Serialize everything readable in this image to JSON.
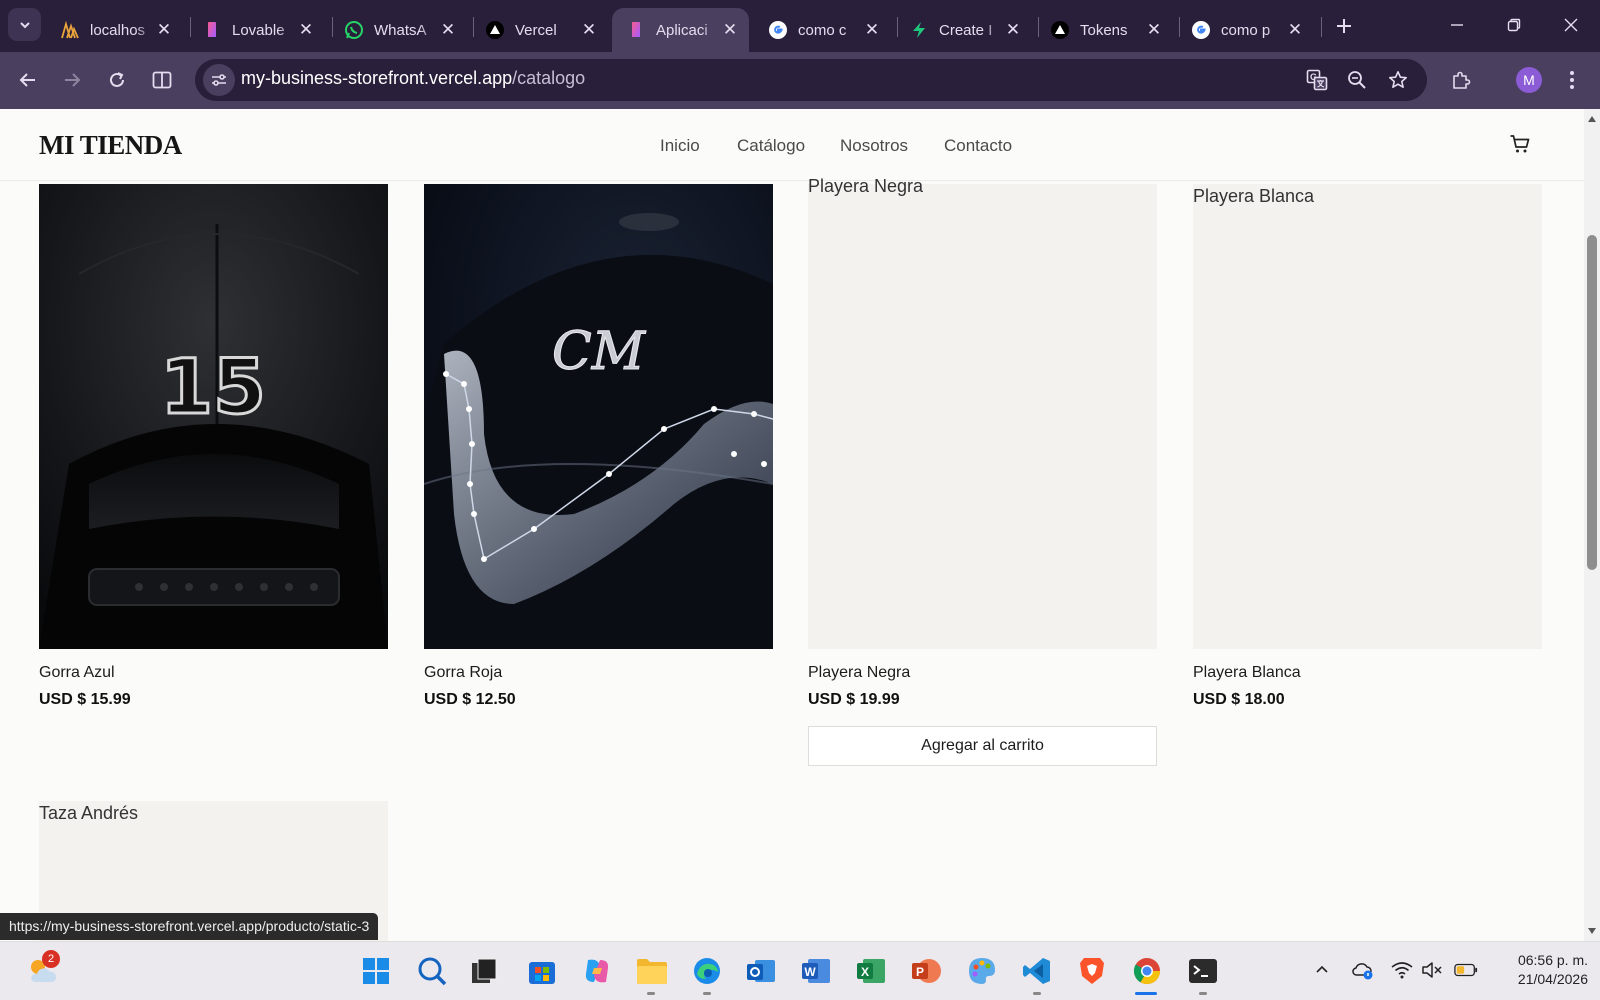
{
  "browser": {
    "tabs": [
      {
        "title": "localhos",
        "favicon": "localhost-favicon",
        "active": false
      },
      {
        "title": "Lovable",
        "favicon": "lovable-favicon",
        "active": false
      },
      {
        "title": "WhatsA",
        "favicon": "whatsapp-favicon",
        "active": false
      },
      {
        "title": "Vercel",
        "favicon": "vercel-favicon",
        "active": false
      },
      {
        "title": "Aplicaci",
        "favicon": "lovable-favicon",
        "active": true
      },
      {
        "title": "como c",
        "favicon": "google-favicon",
        "active": false
      },
      {
        "title": "Create I",
        "favicon": "bolt-favicon",
        "active": false
      },
      {
        "title": "Tokens",
        "favicon": "vercel-favicon",
        "active": false
      },
      {
        "title": "como p",
        "favicon": "google-favicon",
        "active": false
      }
    ],
    "url_domain": "my-business-storefront.vercel.app",
    "url_path": "/catalogo",
    "profile_initial": "M",
    "status_url": "https://my-business-storefront.vercel.app/producto/static-3",
    "colors": {
      "chrome_dark": "#2a1f3a",
      "chrome_toolbar": "#4a3f5e",
      "profile": "#8b5cd6"
    }
  },
  "site": {
    "logo": "MI TIENDA",
    "nav": {
      "home": "Inicio",
      "catalog": "Catálogo",
      "about": "Nosotros",
      "contact": "Contacto"
    },
    "products": [
      {
        "name": "Gorra Azul",
        "price": "USD $ 15.99",
        "image": "cap-15-photo"
      },
      {
        "name": "Gorra Roja",
        "price": "USD $ 12.50",
        "image": "cap-cm-constellation-photo"
      },
      {
        "name": "Playera Negra",
        "price": "USD $ 19.99",
        "image_alt": "Playera Negra",
        "button": "Agregar al carrito"
      },
      {
        "name": "Playera Blanca",
        "price": "USD $ 18.00",
        "image_alt": "Playera Blanca"
      },
      {
        "image_alt": "Taza Andrés"
      }
    ]
  },
  "taskbar": {
    "weather_badge": "2",
    "time": "06:56 p. m.",
    "date": "21/04/2026"
  }
}
